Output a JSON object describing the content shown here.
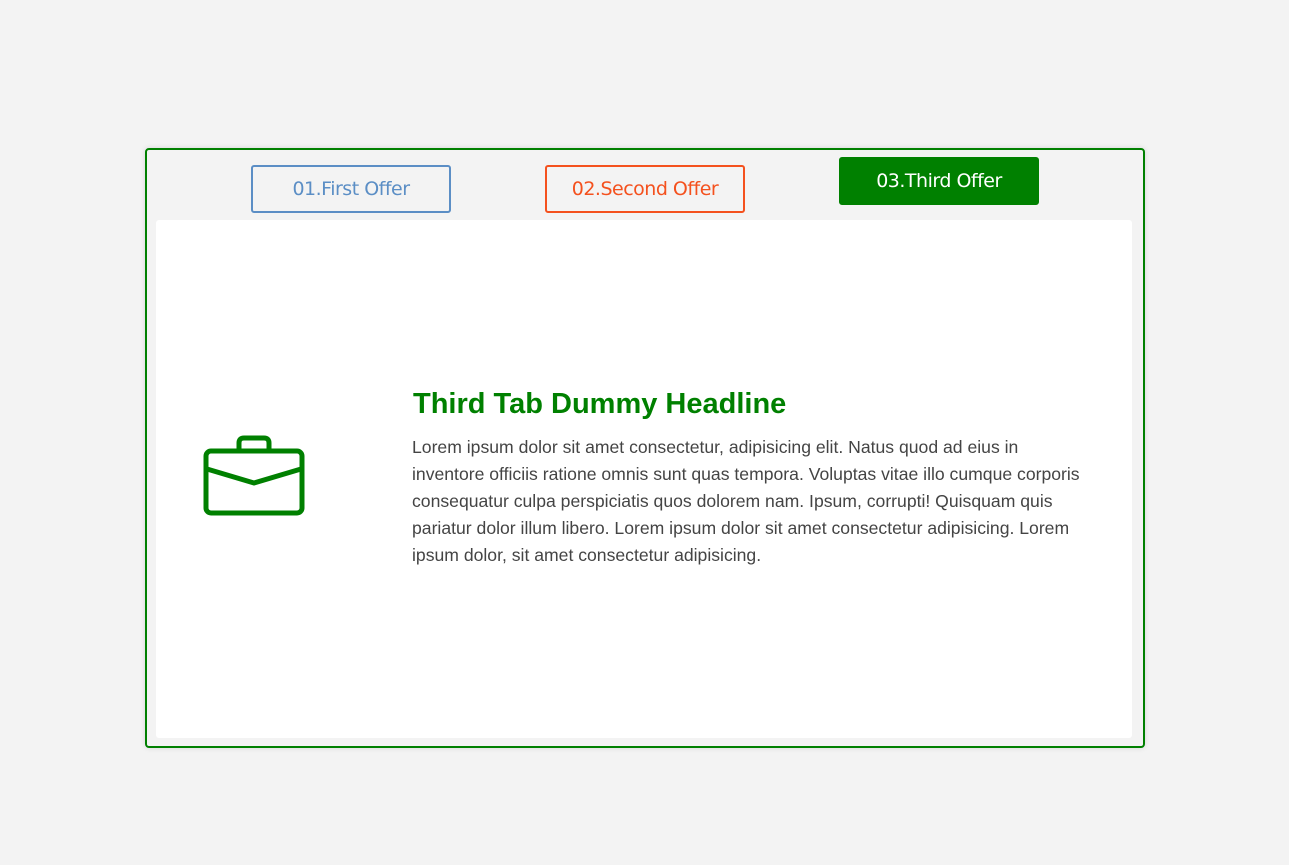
{
  "tabs": [
    {
      "label": "01.First Offer",
      "color": "#5b8ec5",
      "active": false
    },
    {
      "label": "02.Second Offer",
      "color": "#f4511e",
      "active": false
    },
    {
      "label": "03.Third Offer",
      "color": "#008000",
      "active": true
    }
  ],
  "content": {
    "icon": "briefcase-icon",
    "headline": "Third Tab Dummy Headline",
    "body": "Lorem ipsum dolor sit amet consectetur, adipisicing elit. Natus quod ad eius in inventore officiis ratione omnis sunt quas tempora. Voluptas vitae illo cumque corporis consequatur culpa perspiciatis quos dolorem nam. Ipsum, corrupti! Quisquam quis pariatur dolor illum libero. Lorem ipsum dolor sit amet consectetur adipisicing. Lorem ipsum dolor, sit amet consectetur adipisicing."
  },
  "colors": {
    "accent": "#008000",
    "page_background": "#f3f3f3",
    "text": "#444444"
  }
}
